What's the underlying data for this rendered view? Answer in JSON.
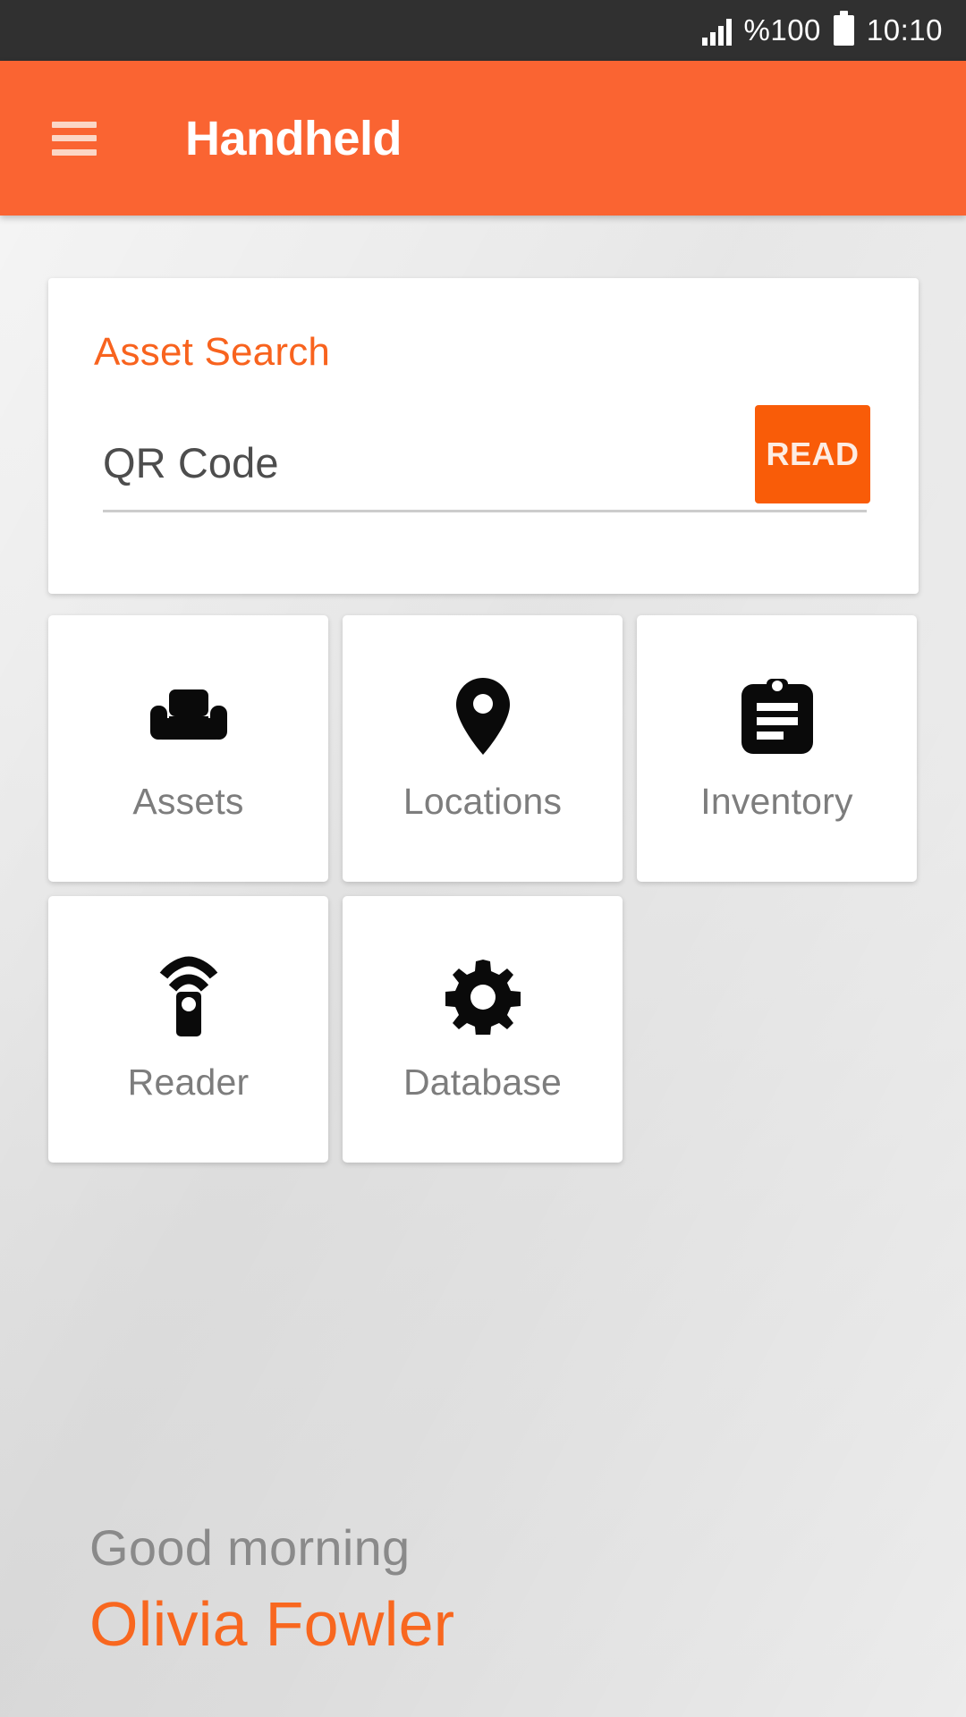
{
  "status_bar": {
    "signal_icon": "signal-bars-icon",
    "battery_percent": "%100",
    "battery_icon": "battery-full-icon",
    "time": "10:10"
  },
  "app_bar": {
    "menu_icon": "hamburger-menu-icon",
    "title": "Handheld",
    "background_color": "#fa6432"
  },
  "asset_search": {
    "title": "Asset Search",
    "title_color": "#f8631e",
    "qr_field": {
      "label": "QR Code",
      "placeholder": "QR Code",
      "value": ""
    },
    "read_button": {
      "label": "READ",
      "background_color": "#f95c08"
    }
  },
  "tiles": [
    {
      "label": "Assets",
      "icon": "sofa-icon"
    },
    {
      "label": "Locations",
      "icon": "map-pin-icon"
    },
    {
      "label": "Inventory",
      "icon": "clipboard-icon"
    },
    {
      "label": "Reader",
      "icon": "rfid-reader-icon"
    },
    {
      "label": "Database",
      "icon": "gear-icon"
    }
  ],
  "greeting": {
    "salutation": "Good morning",
    "user_name": "Olivia Fowler",
    "name_color": "#f8671f"
  }
}
